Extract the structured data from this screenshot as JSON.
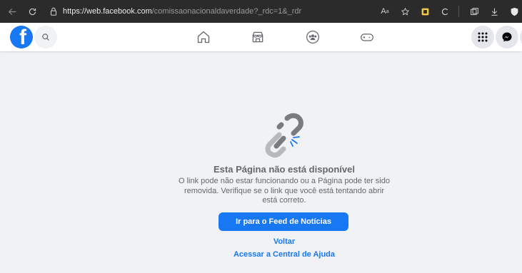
{
  "browser": {
    "url_host": "https://web.facebook.com",
    "url_path": "/comissaonacionaldaverdade?_rdc=1&_rdr",
    "read_aloud_label": "A",
    "colors": {
      "chrome_bg": "#2b2b2b",
      "collections_icon": "#f2c84b"
    }
  },
  "fb_nav": {
    "logo_letter": "f",
    "brand_color": "#1877f2"
  },
  "error_page": {
    "title": "Esta Página não está disponível",
    "description": "O link pode não estar funcionando ou a Página pode ter sido removida. Verifique se o link que você está tentando abrir está correto.",
    "primary_button": "Ir para o Feed de Notícias",
    "back_link": "Voltar",
    "help_link": "Acessar a Central de Ajuda"
  }
}
